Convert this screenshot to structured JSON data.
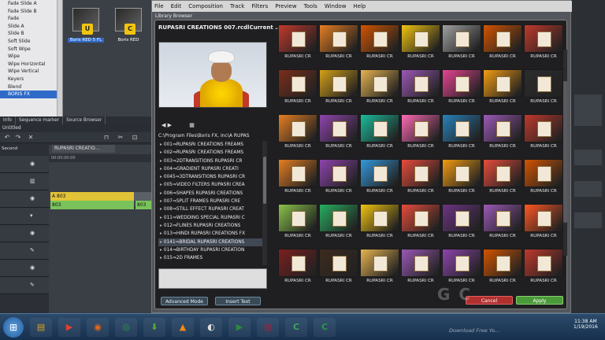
{
  "left_tree": {
    "items": [
      "Fade Slide A",
      "Fade Slide B",
      "Fade",
      "Slide A",
      "Slide B",
      "Soft Slide",
      "Soft Wipe",
      "Wipe",
      "Wipe Horizontal",
      "Wipe Vertical",
      "Keyers",
      "Blend",
      "BORIS FX"
    ],
    "selected_index": 12
  },
  "left_thumbs": [
    {
      "caption": "Boris RED 5 FL",
      "badge": "U",
      "selected": true
    },
    {
      "caption": "Boris RED",
      "badge": "C",
      "selected": false
    }
  ],
  "panel_tabs": [
    "Info",
    "Sequence marker",
    "Source Browser"
  ],
  "timeline": {
    "header": "Untitled",
    "sequence_tab": "RUPASRI CREATIO...",
    "ruler_start": "00:00:00:00",
    "track_label": "Second",
    "clips": [
      {
        "text": "A 803",
        "color": "yellow"
      },
      {
        "text": "803",
        "color": "green"
      },
      {
        "text": "803",
        "color": "green"
      }
    ]
  },
  "menu": [
    "File",
    "Edit",
    "Composition",
    "Track",
    "Filters",
    "Preview",
    "Tools",
    "Window",
    "Help"
  ],
  "library": {
    "panel_title": "Library Browser",
    "header": "RUPASRI CREATIONS 007.rcdlCurrent ...",
    "path": "C:\\Program Files\\Boris FX, Inc\\A RUPAS",
    "tree": [
      "001⇒RUPASRI CREATIONS FREAMS",
      "002⇒RUPASRI CREATIONS FREAMS",
      "003⇒2DTRANSITIONS RUPASRI CR",
      "004⇒GRADIENT RUPASRI CREATI",
      "0045⇒3DTRANSITIONS RUPASRI CR",
      "005⇒VIDEO FILTERS RUPASRI CREA",
      "006⇒SHAPES RUPASRI CREATIONS",
      "007⇒SPLIT FRAMES RUPASRI CRE",
      "008⇒STILL EFFECT RUPASRI CREAT",
      "011⇒WEDDING SPECIAL RUPASRI C",
      "012⇒FLINES RUPASRI CREATIONS",
      "013⇒HINDI RUPASRI CREATIONS FX",
      "0141⇒BRIDAL RUPASRI CREATIONS",
      "014⇒BIRTHDAY RUPASRI CREATION",
      "015⇒2D FRAMES"
    ],
    "selected_tree_index": 12,
    "thumb_label": "RUPASRI CR",
    "thumb_colors": [
      [
        "#c0392b",
        "#e67e22",
        "#d35400",
        "#f1c40f",
        "#a0a0a0",
        "#d35400",
        "#c0392b"
      ],
      [
        "#7a2e1a",
        "#d4a017",
        "#e6b450",
        "#9b59b6",
        "#e84393",
        "#f39c12",
        "#2c2c2c"
      ],
      [
        "#e67e22",
        "#8e44ad",
        "#1abc9c",
        "#ff69b4",
        "#2980b9",
        "#9b59b6",
        "#c0392b"
      ],
      [
        "#e67e22",
        "#8e44ad",
        "#3498db",
        "#e74c3c",
        "#f39c12",
        "#e74c3c",
        "#d35400"
      ],
      [
        "#8bc34a",
        "#27ae60",
        "#f1c40f",
        "#e74c3c",
        "#6c3483",
        "#9b59b6",
        "#ff5722"
      ],
      [
        "#7b1f1f",
        "#3d2b1f",
        "#e6b450",
        "#9b59b6",
        "#8e44ad",
        "#d35400",
        "#c0392b"
      ]
    ],
    "buttons": {
      "advanced": "Advanced Mode",
      "insert": "Insert Text",
      "cancel": "Cancel",
      "apply": "Apply"
    }
  },
  "taskbar": {
    "apps": [
      {
        "name": "folder",
        "glyph": "▤",
        "color": "#e0a020"
      },
      {
        "name": "media-player",
        "glyph": "▶",
        "color": "#e04030"
      },
      {
        "name": "firefox",
        "glyph": "◉",
        "color": "#e66a1a"
      },
      {
        "name": "chrome",
        "glyph": "◎",
        "color": "#2e9e4a"
      },
      {
        "name": "torrent",
        "glyph": "⬇",
        "color": "#5aa83a"
      },
      {
        "name": "vlc",
        "glyph": "▲",
        "color": "#f08a10"
      },
      {
        "name": "steam",
        "glyph": "◐",
        "color": "#e0e0e0"
      },
      {
        "name": "boris",
        "glyph": "▶",
        "color": "#2a8a3a"
      },
      {
        "name": "winrar",
        "glyph": "▦",
        "color": "#8a2a4a"
      },
      {
        "name": "camtasia",
        "glyph": "C",
        "color": "#3aa858"
      },
      {
        "name": "camtasia-2",
        "glyph": "C",
        "color": "#2a9848"
      }
    ],
    "time": "11:38 AM",
    "date": "1/19/2016"
  },
  "watermark": {
    "text": "G            C",
    "sub": "Download Free Yo..."
  }
}
